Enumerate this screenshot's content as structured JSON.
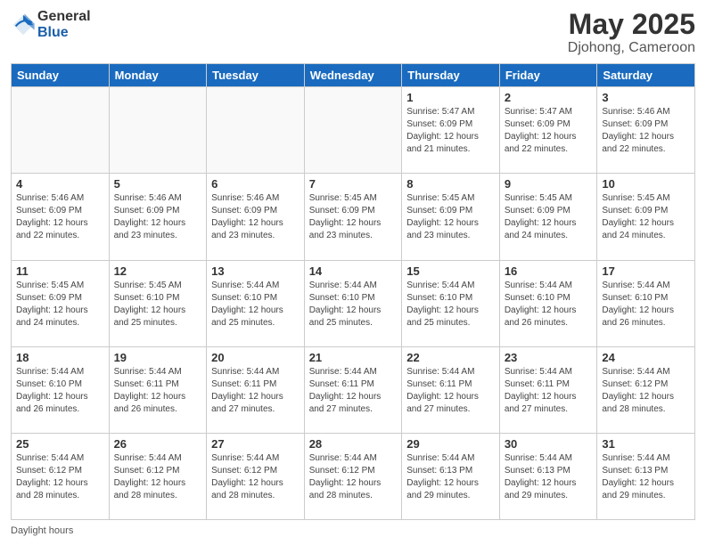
{
  "logo": {
    "general": "General",
    "blue": "Blue"
  },
  "header": {
    "title": "May 2025",
    "subtitle": "Djohong, Cameroon"
  },
  "days_of_week": [
    "Sunday",
    "Monday",
    "Tuesday",
    "Wednesday",
    "Thursday",
    "Friday",
    "Saturday"
  ],
  "weeks": [
    [
      {
        "day": "",
        "info": ""
      },
      {
        "day": "",
        "info": ""
      },
      {
        "day": "",
        "info": ""
      },
      {
        "day": "",
        "info": ""
      },
      {
        "day": "1",
        "info": "Sunrise: 5:47 AM\nSunset: 6:09 PM\nDaylight: 12 hours\nand 21 minutes."
      },
      {
        "day": "2",
        "info": "Sunrise: 5:47 AM\nSunset: 6:09 PM\nDaylight: 12 hours\nand 22 minutes."
      },
      {
        "day": "3",
        "info": "Sunrise: 5:46 AM\nSunset: 6:09 PM\nDaylight: 12 hours\nand 22 minutes."
      }
    ],
    [
      {
        "day": "4",
        "info": "Sunrise: 5:46 AM\nSunset: 6:09 PM\nDaylight: 12 hours\nand 22 minutes."
      },
      {
        "day": "5",
        "info": "Sunrise: 5:46 AM\nSunset: 6:09 PM\nDaylight: 12 hours\nand 23 minutes."
      },
      {
        "day": "6",
        "info": "Sunrise: 5:46 AM\nSunset: 6:09 PM\nDaylight: 12 hours\nand 23 minutes."
      },
      {
        "day": "7",
        "info": "Sunrise: 5:45 AM\nSunset: 6:09 PM\nDaylight: 12 hours\nand 23 minutes."
      },
      {
        "day": "8",
        "info": "Sunrise: 5:45 AM\nSunset: 6:09 PM\nDaylight: 12 hours\nand 23 minutes."
      },
      {
        "day": "9",
        "info": "Sunrise: 5:45 AM\nSunset: 6:09 PM\nDaylight: 12 hours\nand 24 minutes."
      },
      {
        "day": "10",
        "info": "Sunrise: 5:45 AM\nSunset: 6:09 PM\nDaylight: 12 hours\nand 24 minutes."
      }
    ],
    [
      {
        "day": "11",
        "info": "Sunrise: 5:45 AM\nSunset: 6:09 PM\nDaylight: 12 hours\nand 24 minutes."
      },
      {
        "day": "12",
        "info": "Sunrise: 5:45 AM\nSunset: 6:10 PM\nDaylight: 12 hours\nand 25 minutes."
      },
      {
        "day": "13",
        "info": "Sunrise: 5:44 AM\nSunset: 6:10 PM\nDaylight: 12 hours\nand 25 minutes."
      },
      {
        "day": "14",
        "info": "Sunrise: 5:44 AM\nSunset: 6:10 PM\nDaylight: 12 hours\nand 25 minutes."
      },
      {
        "day": "15",
        "info": "Sunrise: 5:44 AM\nSunset: 6:10 PM\nDaylight: 12 hours\nand 25 minutes."
      },
      {
        "day": "16",
        "info": "Sunrise: 5:44 AM\nSunset: 6:10 PM\nDaylight: 12 hours\nand 26 minutes."
      },
      {
        "day": "17",
        "info": "Sunrise: 5:44 AM\nSunset: 6:10 PM\nDaylight: 12 hours\nand 26 minutes."
      }
    ],
    [
      {
        "day": "18",
        "info": "Sunrise: 5:44 AM\nSunset: 6:10 PM\nDaylight: 12 hours\nand 26 minutes."
      },
      {
        "day": "19",
        "info": "Sunrise: 5:44 AM\nSunset: 6:11 PM\nDaylight: 12 hours\nand 26 minutes."
      },
      {
        "day": "20",
        "info": "Sunrise: 5:44 AM\nSunset: 6:11 PM\nDaylight: 12 hours\nand 27 minutes."
      },
      {
        "day": "21",
        "info": "Sunrise: 5:44 AM\nSunset: 6:11 PM\nDaylight: 12 hours\nand 27 minutes."
      },
      {
        "day": "22",
        "info": "Sunrise: 5:44 AM\nSunset: 6:11 PM\nDaylight: 12 hours\nand 27 minutes."
      },
      {
        "day": "23",
        "info": "Sunrise: 5:44 AM\nSunset: 6:11 PM\nDaylight: 12 hours\nand 27 minutes."
      },
      {
        "day": "24",
        "info": "Sunrise: 5:44 AM\nSunset: 6:12 PM\nDaylight: 12 hours\nand 28 minutes."
      }
    ],
    [
      {
        "day": "25",
        "info": "Sunrise: 5:44 AM\nSunset: 6:12 PM\nDaylight: 12 hours\nand 28 minutes."
      },
      {
        "day": "26",
        "info": "Sunrise: 5:44 AM\nSunset: 6:12 PM\nDaylight: 12 hours\nand 28 minutes."
      },
      {
        "day": "27",
        "info": "Sunrise: 5:44 AM\nSunset: 6:12 PM\nDaylight: 12 hours\nand 28 minutes."
      },
      {
        "day": "28",
        "info": "Sunrise: 5:44 AM\nSunset: 6:12 PM\nDaylight: 12 hours\nand 28 minutes."
      },
      {
        "day": "29",
        "info": "Sunrise: 5:44 AM\nSunset: 6:13 PM\nDaylight: 12 hours\nand 29 minutes."
      },
      {
        "day": "30",
        "info": "Sunrise: 5:44 AM\nSunset: 6:13 PM\nDaylight: 12 hours\nand 29 minutes."
      },
      {
        "day": "31",
        "info": "Sunrise: 5:44 AM\nSunset: 6:13 PM\nDaylight: 12 hours\nand 29 minutes."
      }
    ]
  ],
  "footer": {
    "text": "Daylight hours"
  }
}
